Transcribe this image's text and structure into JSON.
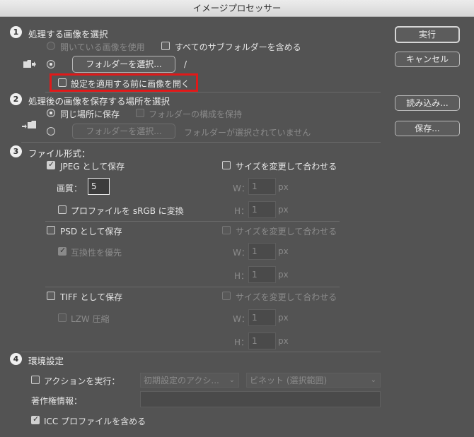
{
  "window": {
    "title": "イメージプロセッサー"
  },
  "section1": {
    "number": "1",
    "title": "処理する画像を選択",
    "use_open_images": "開いている画像を使用",
    "include_subfolders": "すべてのサブフォルダーを含める",
    "select_folder_button": "フォルダーを選択...",
    "folder_path": "/",
    "open_first_label": "設定を適用する前に画像を開く"
  },
  "section2": {
    "number": "2",
    "title": "処理後の画像を保存する場所を選択",
    "same_location": "同じ場所に保存",
    "keep_structure": "フォルダーの構成を保持",
    "select_folder_button": "フォルダーを選択...",
    "no_folder_selected": "フォルダーが選択されていません"
  },
  "section3": {
    "number": "3",
    "title": "ファイル形式：",
    "jpeg": {
      "save_as": "JPEG として保存",
      "resize": "サイズを変更して合わせる",
      "quality_label": "画質：",
      "quality_value": "5",
      "w_label": "W：",
      "w_value": "1",
      "h_label": "H：",
      "h_value": "1",
      "unit": "px",
      "convert_srgb": "プロファイルを sRGB に変換"
    },
    "psd": {
      "save_as": "PSD として保存",
      "resize": "サイズを変更して合わせる",
      "maximize_compat": "互換性を優先",
      "w_label": "W：",
      "w_value": "1",
      "h_label": "H：",
      "h_value": "1",
      "unit": "px"
    },
    "tiff": {
      "save_as": "TIFF として保存",
      "resize": "サイズを変更して合わせる",
      "lzw": "LZW 圧縮",
      "w_label": "W：",
      "w_value": "1",
      "h_label": "H：",
      "h_value": "1",
      "unit": "px"
    }
  },
  "section4": {
    "number": "4",
    "title": "環境設定",
    "run_action": "アクションを実行：",
    "action_set": "初期設定のアクシ...",
    "action_name": "ビネット (選択範囲)",
    "copyright_label": "著作権情報：",
    "copyright_value": "",
    "include_icc": "ICC プロファイルを含める"
  },
  "buttons": {
    "run": "実行",
    "cancel": "キャンセル",
    "load": "読み込み...",
    "save": "保存..."
  },
  "icons": {
    "chevron": "⌄"
  }
}
